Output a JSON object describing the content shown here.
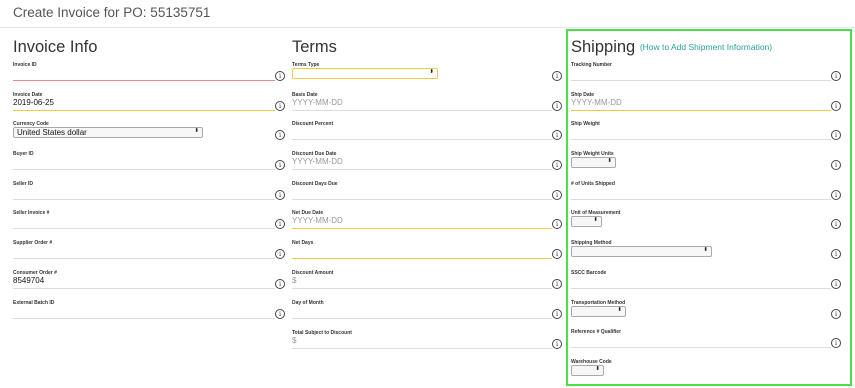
{
  "header": {
    "title": "Create Invoice for PO: 55135751"
  },
  "invoice_info": {
    "heading": "Invoice Info",
    "fields": [
      {
        "label": "Invoice ID",
        "value": ""
      },
      {
        "label": "Invoice Date",
        "value": "2019-06-25"
      },
      {
        "label": "Currency Code",
        "value": "United States dollar"
      },
      {
        "label": "Buyer ID",
        "value": ""
      },
      {
        "label": "Seller ID",
        "value": ""
      },
      {
        "label": "Seller Invoice #",
        "value": ""
      },
      {
        "label": "Supplier Order #",
        "value": ""
      },
      {
        "label": "Consumer Order #",
        "value": "8549704"
      },
      {
        "label": "External Batch ID",
        "value": ""
      }
    ]
  },
  "terms": {
    "heading": "Terms",
    "fields": [
      {
        "label": "Terms Type",
        "value": ""
      },
      {
        "label": "Basis Date",
        "placeholder": "YYYY-MM-DD"
      },
      {
        "label": "Discount Percent",
        "value": ""
      },
      {
        "label": "Discount Due Date",
        "placeholder": "YYYY-MM-DD"
      },
      {
        "label": "Discount Days Due",
        "value": ""
      },
      {
        "label": "Net Due Date",
        "placeholder": "YYYY-MM-DD"
      },
      {
        "label": "Net Days",
        "value": ""
      },
      {
        "label": "Discount Amount",
        "placeholder": "$"
      },
      {
        "label": "Day of Month",
        "value": ""
      },
      {
        "label": "Total Subject to Discount",
        "placeholder": "$"
      }
    ]
  },
  "shipping": {
    "heading": "Shipping",
    "help_link": "(How to Add Shipment Information)",
    "highlight_color": "#4be04b",
    "fields": [
      {
        "label": "Tracking Number",
        "value": ""
      },
      {
        "label": "Ship Date",
        "placeholder": "YYYY-MM-DD"
      },
      {
        "label": "Ship Weight",
        "value": ""
      },
      {
        "label": "Ship Weight Units",
        "value": ""
      },
      {
        "label": "# of Units Shipped",
        "value": ""
      },
      {
        "label": "Unit of Measurement",
        "value": ""
      },
      {
        "label": "Shipping Method",
        "value": ""
      },
      {
        "label": "SSCC Barcode",
        "value": ""
      },
      {
        "label": "Transportation Method",
        "value": ""
      },
      {
        "label": "Reference # Qualifier",
        "value": ""
      },
      {
        "label": "Warehouse Code",
        "value": ""
      }
    ]
  },
  "icons": {
    "info": "info-circle-icon",
    "info_glyph": "i",
    "select_caret": "⬍"
  }
}
